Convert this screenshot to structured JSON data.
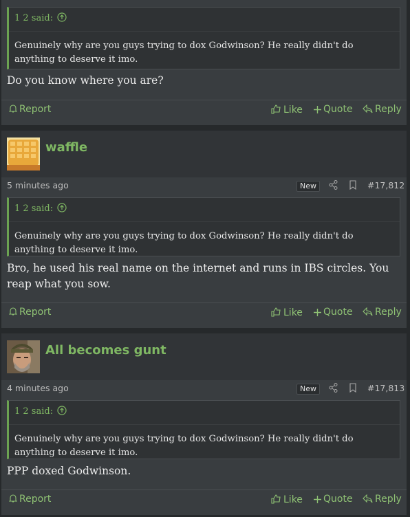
{
  "posts": [
    {
      "quote": {
        "author": "1 2 said:",
        "text": "Genuinely why are you guys trying to dox Godwinson? He really didn't do anything to deserve it imo."
      },
      "message": "Do you know where you are?",
      "actions": {
        "report": "Report",
        "like": "Like",
        "quote": "Quote",
        "reply": "Reply"
      }
    },
    {
      "username": "waffle",
      "time": "5 minutes ago",
      "badge": "New",
      "number": "#17,812",
      "quote": {
        "author": "1 2 said:",
        "text": "Genuinely why are you guys trying to dox Godwinson? He really didn't do anything to deserve it imo."
      },
      "message": "Bro, he used his real name on the internet and runs in IBS circles. You reap what you sow.",
      "actions": {
        "report": "Report",
        "like": "Like",
        "quote": "Quote",
        "reply": "Reply"
      }
    },
    {
      "username": "All becomes gunt",
      "time": "4 minutes ago",
      "badge": "New",
      "number": "#17,813",
      "quote": {
        "author": "1 2 said:",
        "text": "Genuinely why are you guys trying to dox Godwinson? He really didn't do anything to deserve it imo."
      },
      "message": "PPP doxed Godwinson.",
      "actions": {
        "report": "Report",
        "like": "Like",
        "quote": "Quote",
        "reply": "Reply"
      }
    }
  ],
  "colors": {
    "accent": "#7fb763",
    "background": "#26292b",
    "post_bg": "#393d40",
    "header_bg": "#313437"
  },
  "icons": [
    "bell-icon",
    "thumbs-up-icon",
    "plus-icon",
    "reply-icon",
    "share-icon",
    "bookmark-icon",
    "arrow-up-circle-icon"
  ]
}
